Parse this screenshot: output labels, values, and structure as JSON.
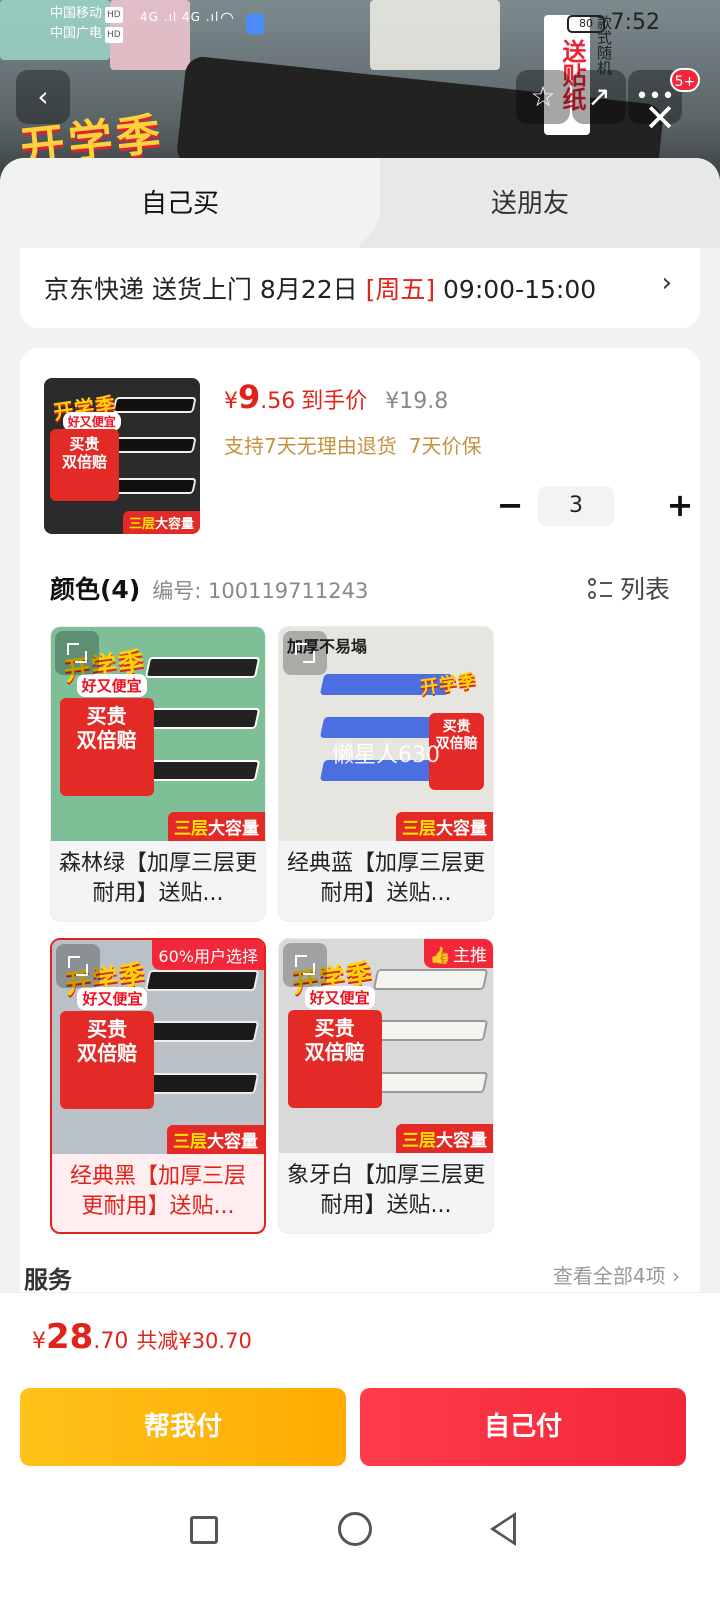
{
  "status_bar": {
    "carrier1": "中国移动",
    "carrier2": "中国广电",
    "hd": "HD",
    "signal": "4G .ıl  4G .ıl",
    "battery": "80",
    "time": "7:52"
  },
  "banner": {
    "promo_text": "开学季",
    "side_label": "送贴纸",
    "side_sub": "款式随机",
    "more_badge": "5+"
  },
  "tabs": {
    "self": "自己买",
    "friend": "送朋友"
  },
  "delivery": {
    "text": "京东快递 送货上门 8月22日 ",
    "weekday": "[周五]",
    "time": " 09:00-15:00"
  },
  "product": {
    "currency": "¥",
    "price_int": "9",
    "price_dec": ".56",
    "price_label": "到手价",
    "original_price": "¥19.8",
    "guarantee1": "支持7天无理由退货",
    "guarantee2": "7天价保",
    "quantity": "3",
    "image": {
      "title": "开学季",
      "sub": "好又便宜",
      "red_line1": "买贵",
      "red_line2": "双倍赔",
      "bottom_a": "三层",
      "bottom_b": "大容量"
    }
  },
  "color_section": {
    "title": "颜色(4)",
    "code": "编号: 100119711243",
    "list_toggle": "列表"
  },
  "variants": [
    {
      "name": "森林绿【加厚三层更耐用】送贴...",
      "bg": "#7fbf98",
      "tray": "#2a2a2a"
    },
    {
      "name": "经典蓝【加厚三层更耐用】送贴...",
      "bg": "#e7e5e0",
      "tray": "#4b6fe0",
      "overlay": "加厚不易塌",
      "watermark": "懒星人630"
    },
    {
      "name": "经典黑【加厚三层更耐用】送贴...",
      "bg": "#b9c0c6",
      "tray": "#1b1b1b",
      "tag": "60%用户选择"
    },
    {
      "name": "象牙白【加厚三层更耐用】送贴...",
      "bg": "#d9d9d9",
      "tray": "#f4f4f0",
      "tag": "主推"
    }
  ],
  "service": {
    "title": "服务",
    "all": "查看全部4项 ›"
  },
  "summary": {
    "currency": "¥",
    "total_int": "28",
    "total_dec": ".70",
    "save": "共减¥30.70"
  },
  "actions": {
    "help_pay": "帮我付",
    "self_pay": "自己付"
  }
}
